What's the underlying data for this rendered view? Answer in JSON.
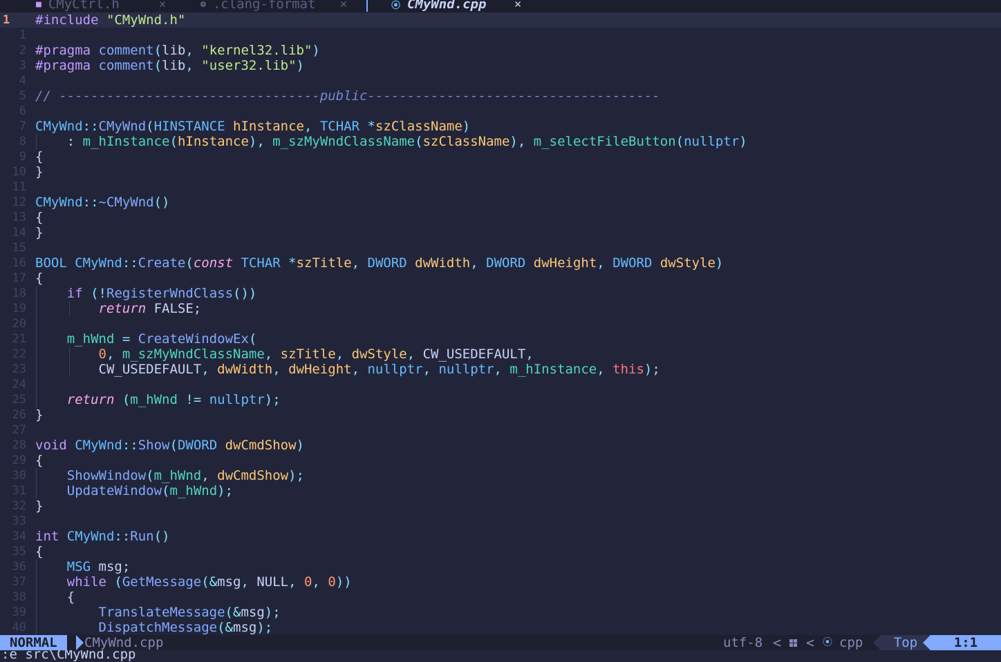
{
  "tabs": [
    {
      "icon": "header-file-icon",
      "icon_glyph": "■",
      "label": "CMyCtrl.h",
      "close": "✕",
      "active": false
    },
    {
      "icon": "gear-icon",
      "icon_glyph": "⚙",
      "label": ".clang-format",
      "close": "✕",
      "active": false
    },
    {
      "icon": "cpp-file-icon",
      "icon_glyph": "⦿",
      "label": "CMyWnd.cpp",
      "close": "✕",
      "active": true
    }
  ],
  "editor": {
    "current_line": "1",
    "lines": [
      {
        "n": "1",
        "segs": [
          [
            "pre",
            "#include "
          ],
          [
            "str",
            "\"CMyWnd.h\""
          ]
        ]
      },
      {
        "n": "1",
        "segs": []
      },
      {
        "n": "2",
        "segs": [
          [
            "pre",
            "#pragma "
          ],
          [
            "fn",
            "comment"
          ],
          [
            "pun",
            "("
          ],
          [
            "const",
            "lib"
          ],
          [
            "pun",
            ", "
          ],
          [
            "str",
            "\"kernel32.lib\""
          ],
          [
            "pun",
            ")"
          ]
        ]
      },
      {
        "n": "3",
        "segs": [
          [
            "pre",
            "#pragma "
          ],
          [
            "fn",
            "comment"
          ],
          [
            "pun",
            "("
          ],
          [
            "const",
            "lib"
          ],
          [
            "pun",
            ", "
          ],
          [
            "str",
            "\"user32.lib\""
          ],
          [
            "pun",
            ")"
          ]
        ]
      },
      {
        "n": "4",
        "segs": []
      },
      {
        "n": "5",
        "segs": [
          [
            "cmt",
            "// ---------------------------------public-------------------------------------"
          ]
        ]
      },
      {
        "n": "6",
        "segs": []
      },
      {
        "n": "7",
        "segs": [
          [
            "cls",
            "CMyWnd"
          ],
          [
            "op",
            "::"
          ],
          [
            "fn",
            "CMyWnd"
          ],
          [
            "pun",
            "("
          ],
          [
            "ty",
            "HINSTANCE "
          ],
          [
            "param",
            "hInstance"
          ],
          [
            "pun",
            ", "
          ],
          [
            "ty",
            "TCHAR "
          ],
          [
            "op",
            "*"
          ],
          [
            "param",
            "szClassName"
          ],
          [
            "pun",
            ")"
          ]
        ]
      },
      {
        "n": "8",
        "segs": [
          [
            "const",
            "    : "
          ],
          [
            "field",
            "m_hInstance"
          ],
          [
            "pun",
            "("
          ],
          [
            "param",
            "hInstance"
          ],
          [
            "pun",
            "), "
          ],
          [
            "field",
            "m_szMyWndClassName"
          ],
          [
            "pun",
            "("
          ],
          [
            "param",
            "szClassName"
          ],
          [
            "pun",
            "), "
          ],
          [
            "field",
            "m_selectFileButton"
          ],
          [
            "pun",
            "("
          ],
          [
            "builtin",
            "nullptr"
          ],
          [
            "pun",
            ")"
          ]
        ]
      },
      {
        "n": "9",
        "segs": [
          [
            "const",
            "{"
          ]
        ]
      },
      {
        "n": "10",
        "segs": [
          [
            "const",
            "}"
          ]
        ]
      },
      {
        "n": "11",
        "segs": []
      },
      {
        "n": "12",
        "segs": [
          [
            "cls",
            "CMyWnd"
          ],
          [
            "op",
            "::"
          ],
          [
            "fn",
            "~CMyWnd"
          ],
          [
            "pun",
            "()"
          ]
        ]
      },
      {
        "n": "13",
        "segs": [
          [
            "const",
            "{"
          ]
        ]
      },
      {
        "n": "14",
        "segs": [
          [
            "const",
            "}"
          ]
        ]
      },
      {
        "n": "15",
        "segs": []
      },
      {
        "n": "16",
        "segs": [
          [
            "ty",
            "BOOL "
          ],
          [
            "cls",
            "CMyWnd"
          ],
          [
            "op",
            "::"
          ],
          [
            "fn",
            "Create"
          ],
          [
            "pun",
            "("
          ],
          [
            "kwi",
            "const "
          ],
          [
            "ty",
            "TCHAR "
          ],
          [
            "op",
            "*"
          ],
          [
            "param",
            "szTitle"
          ],
          [
            "pun",
            ", "
          ],
          [
            "ty",
            "DWORD "
          ],
          [
            "param",
            "dwWidth"
          ],
          [
            "pun",
            ", "
          ],
          [
            "ty",
            "DWORD "
          ],
          [
            "param",
            "dwHeight"
          ],
          [
            "pun",
            ", "
          ],
          [
            "ty",
            "DWORD "
          ],
          [
            "param",
            "dwStyle"
          ],
          [
            "pun",
            ")"
          ]
        ]
      },
      {
        "n": "17",
        "segs": [
          [
            "const",
            "{"
          ]
        ]
      },
      {
        "n": "18",
        "segs": [
          [
            "const",
            "    "
          ],
          [
            "kw",
            "if "
          ],
          [
            "pun",
            "("
          ],
          [
            "op",
            "!"
          ],
          [
            "fn",
            "RegisterWndClass"
          ],
          [
            "pun",
            "())"
          ]
        ]
      },
      {
        "n": "19",
        "segs": [
          [
            "const",
            "        "
          ],
          [
            "kwi",
            "return "
          ],
          [
            "const",
            "FALSE;"
          ]
        ]
      },
      {
        "n": "20",
        "segs": []
      },
      {
        "n": "21",
        "segs": [
          [
            "const",
            "    "
          ],
          [
            "field",
            "m_hWnd "
          ],
          [
            "op",
            "= "
          ],
          [
            "fn",
            "CreateWindowEx"
          ],
          [
            "pun",
            "("
          ]
        ]
      },
      {
        "n": "22",
        "segs": [
          [
            "const",
            "        "
          ],
          [
            "num",
            "0"
          ],
          [
            "pun",
            ", "
          ],
          [
            "field",
            "m_szMyWndClassName"
          ],
          [
            "pun",
            ", "
          ],
          [
            "param",
            "szTitle"
          ],
          [
            "pun",
            ", "
          ],
          [
            "param",
            "dwStyle"
          ],
          [
            "pun",
            ", "
          ],
          [
            "const",
            "CW_USEDEFAULT"
          ],
          [
            "pun",
            ","
          ]
        ]
      },
      {
        "n": "23",
        "segs": [
          [
            "const",
            "        CW_USEDEFAULT"
          ],
          [
            "pun",
            ", "
          ],
          [
            "param",
            "dwWidth"
          ],
          [
            "pun",
            ", "
          ],
          [
            "param",
            "dwHeight"
          ],
          [
            "pun",
            ", "
          ],
          [
            "builtin",
            "nullptr"
          ],
          [
            "pun",
            ", "
          ],
          [
            "builtin",
            "nullptr"
          ],
          [
            "pun",
            ", "
          ],
          [
            "field",
            "m_hInstance"
          ],
          [
            "pun",
            ", "
          ],
          [
            "this",
            "this"
          ],
          [
            "pun",
            ");"
          ]
        ]
      },
      {
        "n": "24",
        "segs": []
      },
      {
        "n": "25",
        "segs": [
          [
            "const",
            "    "
          ],
          [
            "kwi",
            "return "
          ],
          [
            "pun",
            "("
          ],
          [
            "field",
            "m_hWnd "
          ],
          [
            "op",
            "!= "
          ],
          [
            "builtin",
            "nullptr"
          ],
          [
            "pun",
            ");"
          ]
        ]
      },
      {
        "n": "26",
        "segs": [
          [
            "const",
            "}"
          ]
        ]
      },
      {
        "n": "27",
        "segs": []
      },
      {
        "n": "28",
        "segs": [
          [
            "kw",
            "void "
          ],
          [
            "cls",
            "CMyWnd"
          ],
          [
            "op",
            "::"
          ],
          [
            "fn",
            "Show"
          ],
          [
            "pun",
            "("
          ],
          [
            "ty",
            "DWORD "
          ],
          [
            "param",
            "dwCmdShow"
          ],
          [
            "pun",
            ")"
          ]
        ]
      },
      {
        "n": "29",
        "segs": [
          [
            "const",
            "{"
          ]
        ]
      },
      {
        "n": "30",
        "segs": [
          [
            "const",
            "    "
          ],
          [
            "fn",
            "ShowWindow"
          ],
          [
            "pun",
            "("
          ],
          [
            "field",
            "m_hWnd"
          ],
          [
            "pun",
            ", "
          ],
          [
            "param",
            "dwCmdShow"
          ],
          [
            "pun",
            ");"
          ]
        ]
      },
      {
        "n": "31",
        "segs": [
          [
            "const",
            "    "
          ],
          [
            "fn",
            "UpdateWindow"
          ],
          [
            "pun",
            "("
          ],
          [
            "field",
            "m_hWnd"
          ],
          [
            "pun",
            ");"
          ]
        ]
      },
      {
        "n": "32",
        "segs": [
          [
            "const",
            "}"
          ]
        ]
      },
      {
        "n": "33",
        "segs": []
      },
      {
        "n": "34",
        "segs": [
          [
            "kw",
            "int "
          ],
          [
            "cls",
            "CMyWnd"
          ],
          [
            "op",
            "::"
          ],
          [
            "fn",
            "Run"
          ],
          [
            "pun",
            "()"
          ]
        ]
      },
      {
        "n": "35",
        "segs": [
          [
            "const",
            "{"
          ]
        ]
      },
      {
        "n": "36",
        "segs": [
          [
            "const",
            "    "
          ],
          [
            "ty",
            "MSG "
          ],
          [
            "const",
            "msg;"
          ]
        ]
      },
      {
        "n": "37",
        "segs": [
          [
            "const",
            "    "
          ],
          [
            "kw",
            "while "
          ],
          [
            "pun",
            "("
          ],
          [
            "fn",
            "GetMessage"
          ],
          [
            "pun",
            "(&"
          ],
          [
            "const",
            "msg"
          ],
          [
            "pun",
            ", "
          ],
          [
            "const",
            "NULL"
          ],
          [
            "pun",
            ", "
          ],
          [
            "num",
            "0"
          ],
          [
            "pun",
            ", "
          ],
          [
            "num",
            "0"
          ],
          [
            "pun",
            "))"
          ]
        ]
      },
      {
        "n": "38",
        "segs": [
          [
            "const",
            "    {"
          ]
        ]
      },
      {
        "n": "39",
        "segs": [
          [
            "const",
            "        "
          ],
          [
            "fn",
            "TranslateMessage"
          ],
          [
            "pun",
            "(&"
          ],
          [
            "const",
            "msg"
          ],
          [
            "pun",
            ");"
          ]
        ]
      },
      {
        "n": "40",
        "segs": [
          [
            "const",
            "        "
          ],
          [
            "fn",
            "DispatchMessage"
          ],
          [
            "pun",
            "(&"
          ],
          [
            "const",
            "msg"
          ],
          [
            "pun",
            ");"
          ]
        ]
      }
    ]
  },
  "statusline": {
    "mode": "NORMAL",
    "filename": "CMyWnd.cpp",
    "encoding": "utf-8",
    "separator": "<",
    "os_icon": "windows-icon",
    "filetype_icon_glyph": "⦿",
    "filetype": "cpp",
    "position": "Top",
    "cursor": "1:1"
  },
  "cmdline": {
    "text": ":e src\\CMyWnd.cpp"
  },
  "colors": {
    "background": "#22253a",
    "accent": "#82aaff",
    "line_number_current": "#ff966c"
  }
}
